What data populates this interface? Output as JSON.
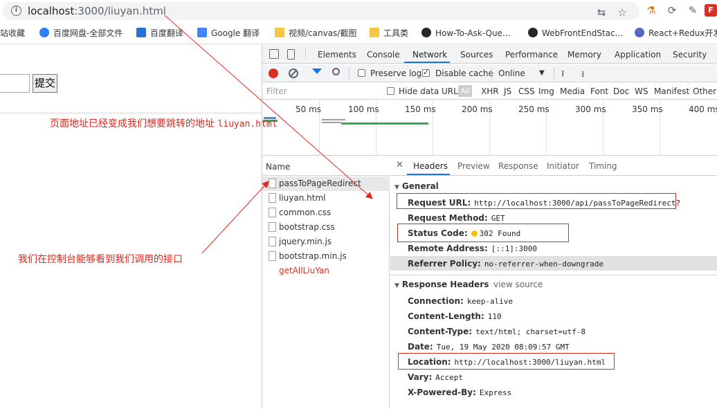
{
  "browser": {
    "url_host": "localhost",
    "url_rest": ":3000/liuyan.html",
    "bookmarks": [
      "站收藏",
      "百度网盘-全部文件",
      "百度翻译",
      "Google 翻译",
      "视频/canvas/截图",
      "工具类",
      "How-To-Ask-Que...",
      "WebFrontEndStac...",
      "React+Redux开发"
    ],
    "bookmark_icons": [
      "",
      "cloud-icon",
      "translate-icon",
      "google-translate-icon",
      "folder-icon",
      "folder-icon",
      "github-icon",
      "github-icon",
      "react-icon"
    ]
  },
  "page": {
    "submit_label": "提交"
  },
  "annotations": {
    "top_text": "页面地址已经变成我们想要跳转的地址 ",
    "top_code": "liuyan.html",
    "left_text": "我们在控制台能够看到我们调用的接口"
  },
  "devtools": {
    "tabs": [
      "Elements",
      "Console",
      "Network",
      "Sources",
      "Performance",
      "Memory",
      "Application",
      "Security"
    ],
    "toolbar": {
      "preserve_log": "Preserve log",
      "disable_cache": "Disable cache",
      "throttle": "Online"
    },
    "filter": {
      "placeholder": "Filter",
      "hide_data_urls": "Hide data URLs",
      "all": "All",
      "types": [
        "XHR",
        "JS",
        "CSS",
        "Img",
        "Media",
        "Font",
        "Doc",
        "WS",
        "Manifest",
        "Other"
      ]
    },
    "timeline": [
      "50 ms",
      "100 ms",
      "150 ms",
      "200 ms",
      "250 ms",
      "300 ms",
      "350 ms",
      "400 ms"
    ],
    "name_header": "Name",
    "requests": [
      {
        "name": "passToPageRedirect",
        "error": false
      },
      {
        "name": "liuyan.html",
        "error": false
      },
      {
        "name": "common.css",
        "error": false
      },
      {
        "name": "bootstrap.css",
        "error": false
      },
      {
        "name": "jquery.min.js",
        "error": false
      },
      {
        "name": "bootstrap.min.js",
        "error": false
      },
      {
        "name": "getAllLiuYan",
        "error": true
      }
    ],
    "detail_tabs": [
      "Headers",
      "Preview",
      "Response",
      "Initiator",
      "Timing"
    ],
    "general": {
      "title": "General",
      "request_url_k": "Request URL:",
      "request_url_v": "http://localhost:3000/api/passToPageRedirect?",
      "request_method_k": "Request Method:",
      "request_method_v": "GET",
      "status_code_k": "Status Code:",
      "status_code_v": "302 Found",
      "remote_address_k": "Remote Address:",
      "remote_address_v": "[::1]:3000",
      "referrer_policy_k": "Referrer Policy:",
      "referrer_policy_v": "no-referrer-when-downgrade"
    },
    "response_headers": {
      "title": "Response Headers",
      "view_source": "view source",
      "connection_k": "Connection:",
      "connection_v": "keep-alive",
      "content_length_k": "Content-Length:",
      "content_length_v": "110",
      "content_type_k": "Content-Type:",
      "content_type_v": "text/html; charset=utf-8",
      "date_k": "Date:",
      "date_v": "Tue, 19 May 2020 08:09:57 GMT",
      "location_k": "Location:",
      "location_v": "http://localhost:3000/liuyan.html",
      "vary_k": "Vary:",
      "vary_v": "Accept",
      "powered_k": "X-Powered-By:",
      "powered_v": "Express"
    }
  },
  "colors": {
    "accent": "#1a73e8",
    "annotation": "#e0271d",
    "error": "#d93025"
  }
}
